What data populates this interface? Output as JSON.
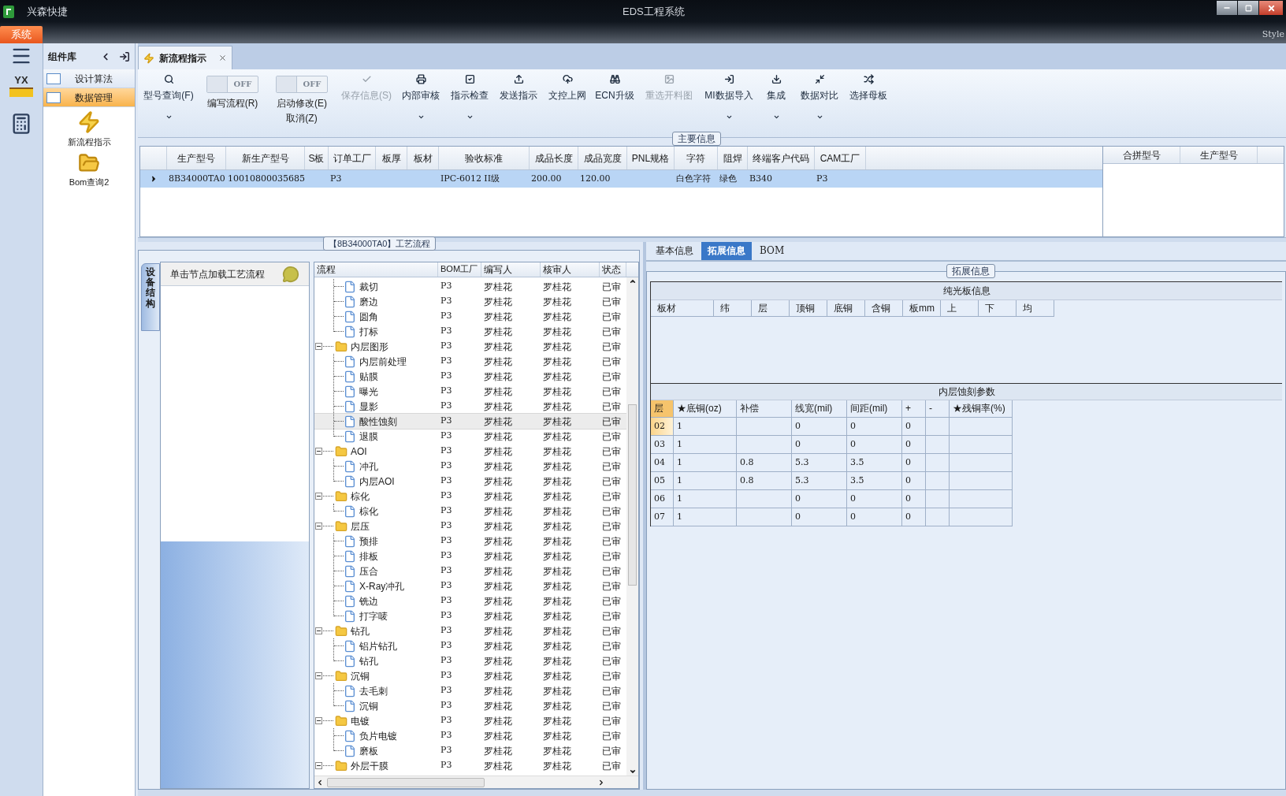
{
  "titlebar": {
    "app_name": "兴森快捷",
    "title": "EDS工程系统",
    "menu_tab": "系统",
    "style_label": "Style"
  },
  "rail": {
    "logo_text": "YX"
  },
  "side_panel": {
    "title": "组件库",
    "items": [
      {
        "label": "设计算法",
        "selected": false
      },
      {
        "label": "数据管理",
        "selected": true
      }
    ],
    "shortcuts": [
      {
        "label": "新流程指示"
      },
      {
        "label": "Bom查询2"
      }
    ]
  },
  "doc_tab": {
    "label": "新流程指示"
  },
  "toolbar": [
    {
      "kind": "button",
      "label": "型号查询(F)",
      "dropdown": true,
      "disabled": false
    },
    {
      "kind": "toggle",
      "label": "编写流程(R)",
      "switch_text": "OFF",
      "on": false
    },
    {
      "kind": "toggle",
      "label": "启动修改(E)",
      "label2": "取消(Z)",
      "switch_text": "OFF",
      "on": false
    },
    {
      "kind": "button",
      "label": "保存信息(S)",
      "dropdown": false,
      "disabled": true
    },
    {
      "kind": "button",
      "label": "内部审核",
      "dropdown": true,
      "disabled": false
    },
    {
      "kind": "button",
      "label": "指示检查",
      "dropdown": true,
      "disabled": false
    },
    {
      "kind": "button",
      "label": "发送指示",
      "dropdown": false,
      "disabled": false
    },
    {
      "kind": "button",
      "label": "文控上网",
      "dropdown": false,
      "disabled": false
    },
    {
      "kind": "button",
      "label": "ECN升级",
      "dropdown": false,
      "disabled": false
    },
    {
      "kind": "button",
      "label": "重选开料图",
      "dropdown": false,
      "disabled": true
    },
    {
      "kind": "button",
      "label": "MI数据导入",
      "dropdown": true,
      "disabled": false
    },
    {
      "kind": "button",
      "label": "集成",
      "dropdown": true,
      "disabled": false
    },
    {
      "kind": "button",
      "label": "数据对比",
      "dropdown": true,
      "disabled": false
    },
    {
      "kind": "button",
      "label": "选择母板",
      "dropdown": false,
      "disabled": false
    }
  ],
  "main_info": {
    "title": "主要信息",
    "columns": [
      "生产型号",
      "新生产型号",
      "S板",
      "订单工厂",
      "板厚",
      "板材",
      "验收标准",
      "成品长度",
      "成品宽度",
      "PNL规格",
      "字符",
      "阻焊",
      "终端客户代码",
      "CAM工厂"
    ],
    "rows": [
      {
        "selected": true,
        "cells": [
          "8B34000TA0",
          "10010800035685",
          "",
          "P3",
          "",
          "",
          "IPC-6012 II级",
          "200.00",
          "120.00",
          "",
          "白色字符",
          "绿色",
          "B340",
          "P3"
        ]
      }
    ],
    "side_columns": [
      "合拼型号",
      "生产型号"
    ]
  },
  "process": {
    "title": "【8B34000TA0】工艺流程",
    "vertical_tab": "设备结构",
    "hint": "单击节点加载工艺流程",
    "columns": [
      "流程",
      "BOM工厂",
      "编写人",
      "核审人",
      "状态"
    ],
    "groups": [
      {
        "children": [
          {
            "label": "裁切",
            "bom": "P3",
            "writer": "罗桂花",
            "reviewer": "罗桂花",
            "status": "已审",
            "selected": false
          },
          {
            "label": "磨边",
            "bom": "P3",
            "writer": "罗桂花",
            "reviewer": "罗桂花",
            "status": "已审",
            "selected": false
          },
          {
            "label": "圆角",
            "bom": "P3",
            "writer": "罗桂花",
            "reviewer": "罗桂花",
            "status": "已审",
            "selected": false
          },
          {
            "label": "打标",
            "bom": "P3",
            "writer": "罗桂花",
            "reviewer": "罗桂花",
            "status": "已审",
            "selected": false
          }
        ]
      },
      {
        "label": "内层图形",
        "bom": "P3",
        "writer": "罗桂花",
        "reviewer": "罗桂花",
        "status": "已审",
        "selected": false,
        "expanded": true,
        "children": [
          {
            "label": "内层前处理",
            "bom": "P3",
            "writer": "罗桂花",
            "reviewer": "罗桂花",
            "status": "已审",
            "selected": false
          },
          {
            "label": "贴膜",
            "bom": "P3",
            "writer": "罗桂花",
            "reviewer": "罗桂花",
            "status": "已审",
            "selected": false
          },
          {
            "label": "曝光",
            "bom": "P3",
            "writer": "罗桂花",
            "reviewer": "罗桂花",
            "status": "已审",
            "selected": false
          },
          {
            "label": "显影",
            "bom": "P3",
            "writer": "罗桂花",
            "reviewer": "罗桂花",
            "status": "已审",
            "selected": false
          },
          {
            "label": "酸性蚀刻",
            "bom": "P3",
            "writer": "罗桂花",
            "reviewer": "罗桂花",
            "status": "已审",
            "selected": true
          },
          {
            "label": "退膜",
            "bom": "P3",
            "writer": "罗桂花",
            "reviewer": "罗桂花",
            "status": "已审",
            "selected": false
          }
        ]
      },
      {
        "label": "AOI",
        "bom": "P3",
        "writer": "罗桂花",
        "reviewer": "罗桂花",
        "status": "已审",
        "selected": false,
        "expanded": true,
        "children": [
          {
            "label": "冲孔",
            "bom": "P3",
            "writer": "罗桂花",
            "reviewer": "罗桂花",
            "status": "已审",
            "selected": false
          },
          {
            "label": "内层AOI",
            "bom": "P3",
            "writer": "罗桂花",
            "reviewer": "罗桂花",
            "status": "已审",
            "selected": false
          }
        ]
      },
      {
        "label": "棕化",
        "bom": "P3",
        "writer": "罗桂花",
        "reviewer": "罗桂花",
        "status": "已审",
        "selected": false,
        "expanded": true,
        "children": [
          {
            "label": "棕化",
            "bom": "P3",
            "writer": "罗桂花",
            "reviewer": "罗桂花",
            "status": "已审",
            "selected": false
          }
        ]
      },
      {
        "label": "层压",
        "bom": "P3",
        "writer": "罗桂花",
        "reviewer": "罗桂花",
        "status": "已审",
        "selected": false,
        "expanded": true,
        "children": [
          {
            "label": "预排",
            "bom": "P3",
            "writer": "罗桂花",
            "reviewer": "罗桂花",
            "status": "已审",
            "selected": false
          },
          {
            "label": "排板",
            "bom": "P3",
            "writer": "罗桂花",
            "reviewer": "罗桂花",
            "status": "已审",
            "selected": false
          },
          {
            "label": "压合",
            "bom": "P3",
            "writer": "罗桂花",
            "reviewer": "罗桂花",
            "status": "已审",
            "selected": false
          },
          {
            "label": "X-Ray冲孔",
            "bom": "P3",
            "writer": "罗桂花",
            "reviewer": "罗桂花",
            "status": "已审",
            "selected": false
          },
          {
            "label": "铣边",
            "bom": "P3",
            "writer": "罗桂花",
            "reviewer": "罗桂花",
            "status": "已审",
            "selected": false
          },
          {
            "label": "打字唛",
            "bom": "P3",
            "writer": "罗桂花",
            "reviewer": "罗桂花",
            "status": "已审",
            "selected": false
          }
        ]
      },
      {
        "label": "钻孔",
        "bom": "P3",
        "writer": "罗桂花",
        "reviewer": "罗桂花",
        "status": "已审",
        "selected": false,
        "expanded": true,
        "children": [
          {
            "label": "铝片钻孔",
            "bom": "P3",
            "writer": "罗桂花",
            "reviewer": "罗桂花",
            "status": "已审",
            "selected": false
          },
          {
            "label": "钻孔",
            "bom": "P3",
            "writer": "罗桂花",
            "reviewer": "罗桂花",
            "status": "已审",
            "selected": false
          }
        ]
      },
      {
        "label": "沉铜",
        "bom": "P3",
        "writer": "罗桂花",
        "reviewer": "罗桂花",
        "status": "已审",
        "selected": false,
        "expanded": true,
        "children": [
          {
            "label": "去毛刺",
            "bom": "P3",
            "writer": "罗桂花",
            "reviewer": "罗桂花",
            "status": "已审",
            "selected": false
          },
          {
            "label": "沉铜",
            "bom": "P3",
            "writer": "罗桂花",
            "reviewer": "罗桂花",
            "status": "已审",
            "selected": false
          }
        ]
      },
      {
        "label": "电镀",
        "bom": "P3",
        "writer": "罗桂花",
        "reviewer": "罗桂花",
        "status": "已审",
        "selected": false,
        "expanded": true,
        "children": [
          {
            "label": "负片电镀",
            "bom": "P3",
            "writer": "罗桂花",
            "reviewer": "罗桂花",
            "status": "已审",
            "selected": false
          },
          {
            "label": "磨板",
            "bom": "P3",
            "writer": "罗桂花",
            "reviewer": "罗桂花",
            "status": "已审",
            "selected": false
          }
        ]
      },
      {
        "label": "外层干膜",
        "bom": "P3",
        "writer": "罗桂花",
        "reviewer": "罗桂花",
        "status": "已审",
        "selected": false,
        "expanded": true
      }
    ]
  },
  "detail": {
    "tabs": [
      {
        "label": "基本信息",
        "selected": false
      },
      {
        "label": "拓展信息",
        "selected": true
      },
      {
        "label": "BOM",
        "selected": false
      }
    ],
    "group_title": "拓展信息",
    "bare_board": {
      "title": "纯光板信息",
      "columns": [
        "板材",
        "纬",
        "层",
        "顶铜",
        "底铜",
        "含铜",
        "板mm",
        "上",
        "下",
        "均"
      ]
    },
    "etch": {
      "title": "内层蚀刻参数",
      "columns": [
        "层",
        "★底铜(oz)",
        "补偿",
        "线宽(mil)",
        "间距(mil)",
        "+",
        "-",
        "★残铜率(%)"
      ],
      "rows": [
        {
          "selected": true,
          "cells": [
            "02",
            "1",
            "",
            "0",
            "0",
            "0",
            "",
            ""
          ]
        },
        {
          "selected": false,
          "cells": [
            "03",
            "1",
            "",
            "0",
            "0",
            "0",
            "",
            ""
          ]
        },
        {
          "selected": false,
          "cells": [
            "04",
            "1",
            "0.8",
            "5.3",
            "3.5",
            "0",
            "",
            ""
          ]
        },
        {
          "selected": false,
          "cells": [
            "05",
            "1",
            "0.8",
            "5.3",
            "3.5",
            "0",
            "",
            ""
          ]
        },
        {
          "selected": false,
          "cells": [
            "06",
            "1",
            "",
            "0",
            "0",
            "0",
            "",
            ""
          ]
        },
        {
          "selected": false,
          "cells": [
            "07",
            "1",
            "",
            "0",
            "0",
            "0",
            "",
            ""
          ]
        }
      ]
    }
  }
}
